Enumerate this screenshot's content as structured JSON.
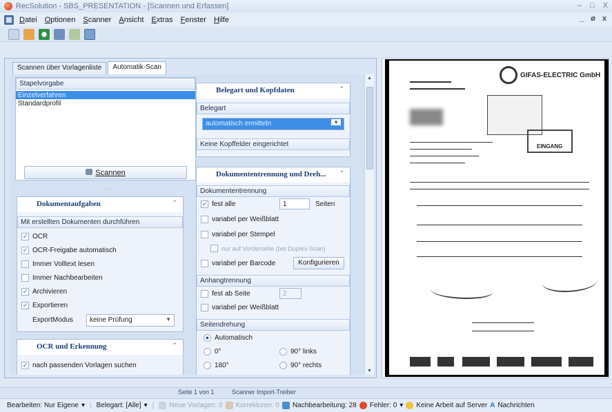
{
  "window": {
    "title": "RecSolution - SBS_PRESENTATION - [Scannen und Erfassen]",
    "controls": [
      "–",
      "□",
      "X"
    ],
    "mdi_controls": [
      "_",
      "ø",
      "x"
    ]
  },
  "menu": [
    "Datei",
    "Optionen",
    "Scanner",
    "Ansicht",
    "Extras",
    "Fenster",
    "Hilfe"
  ],
  "toolbar_icons": [
    "open-icon",
    "people-icon",
    "refresh-icon",
    "scanner-icon",
    "settings-icon",
    "layout-icon"
  ],
  "tabs": [
    "Scannen über Vorlagenliste",
    "Automatik-Scan"
  ],
  "stapel": {
    "title": "Stapelvorgabe",
    "items": [
      "Einzelverfahren",
      "Standardprofil"
    ],
    "scan_button": "Scannen",
    "dots": "....."
  },
  "dokumentaufgaben": {
    "title": "Dokumentaufgaben",
    "subtitle": "Mit erstellten Dokumenten durchführen",
    "options": [
      {
        "label": "OCR",
        "checked": true
      },
      {
        "label": "OCR-Freigabe automatisch",
        "checked": true
      },
      {
        "label": "Immer Volltext lesen",
        "checked": false
      },
      {
        "label": "Immer Nachbearbeiten",
        "checked": false
      },
      {
        "label": "Archivieren",
        "checked": true
      },
      {
        "label": "Exportieren",
        "checked": true
      }
    ],
    "export_label": "ExportModus",
    "export_value": "keine Prüfung"
  },
  "ocr": {
    "title": "OCR und Erkennung",
    "option": "nach passenden Vorlagen suchen"
  },
  "belegart": {
    "title": "Belegart und Kopfdaten",
    "sub": "Belegart",
    "value": "automatisch ermitteln",
    "keine": "Keine Kopffelder eingerichtet"
  },
  "trennung": {
    "title": "Dokumententrennung und Dreh...",
    "sub": "Dokumententrennung",
    "fest_label": "fest alle",
    "fest_value": "1",
    "seiten": "Seiten",
    "weiss": "variabel per Weißblatt",
    "stempel": "variabel per Stempel",
    "vorderseite": "nur auf Vorderseite (bei Duplex-Scan)",
    "barcode": "variabel per Barcode",
    "konfig": "Konfigurieren",
    "anhang_sub": "Anhangtrennung",
    "anhang_fest": "fest ab Seite",
    "anhang_value": "2",
    "anhang_weiss": "variabel per Weißblatt",
    "dreh_sub": "Seitendrehung",
    "auto": "Automatisch",
    "r0": "0°",
    "r90l": "90° links",
    "r180": "180°",
    "r90r": "90° rechts"
  },
  "status1": {
    "page": "Seite 1 von 1",
    "driver": "Scanner Import-Treiber"
  },
  "status2": {
    "bearbeiten": "Bearbeiten: Nur Eigene",
    "belegart": "Belegart: [Alle]",
    "neue": "Neue Vorlagen: 0",
    "korrektur": "Korrekturen: 0",
    "nachbearbeitung": "Nachbearbeitung: 28",
    "fehler": "Fehler: 0",
    "keine_arbeit": "Keine Arbeit auf Server",
    "nachrichten": "Nachrichten"
  },
  "doc": {
    "company": "GIFAS-ELECTRIC GmbH",
    "stamp": "EINGANG"
  },
  "colors": {
    "accent": "#3d8ee6",
    "header_text": "#1c3f72",
    "panel_bg": "#eef3fb"
  }
}
